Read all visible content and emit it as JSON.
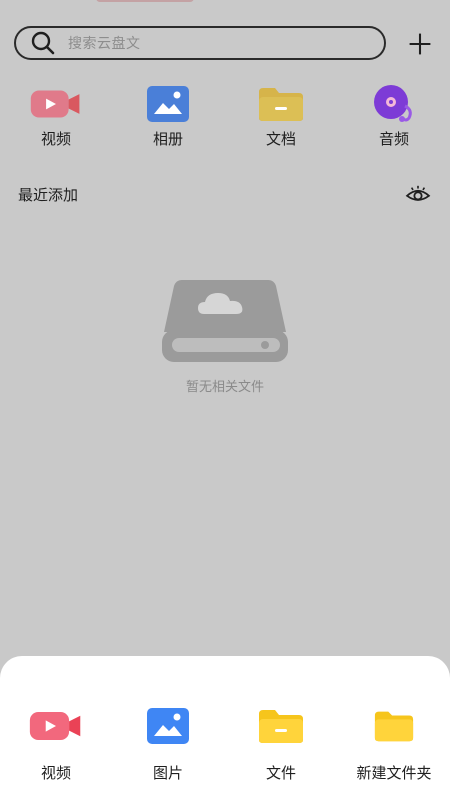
{
  "search": {
    "placeholder": "搜索云盘文",
    "icon": "search-icon"
  },
  "header": {
    "add_icon": "plus-icon"
  },
  "categories": [
    {
      "label": "视频",
      "icon": "video-camera-icon",
      "color": "#e07a8a"
    },
    {
      "label": "相册",
      "icon": "photo-album-icon",
      "color": "#4a7fd8"
    },
    {
      "label": "文档",
      "icon": "document-folder-icon",
      "color": "#d6b44a"
    },
    {
      "label": "音频",
      "icon": "music-disc-icon",
      "color": "#7d3bd6"
    }
  ],
  "recent": {
    "title": "最近添加",
    "toggle_icon": "eye-icon",
    "empty_text": "暂无相关文件",
    "empty_icon": "cloud-drive-icon"
  },
  "sheet": {
    "items": [
      {
        "label": "视频",
        "icon": "video-camera-icon",
        "color": "#f2687d"
      },
      {
        "label": "图片",
        "icon": "image-icon",
        "color": "#3f86f4"
      },
      {
        "label": "文件",
        "icon": "file-folder-icon",
        "color": "#ffd43b"
      },
      {
        "label": "新建文件夹",
        "icon": "new-folder-icon",
        "color": "#ffd43b"
      }
    ]
  }
}
